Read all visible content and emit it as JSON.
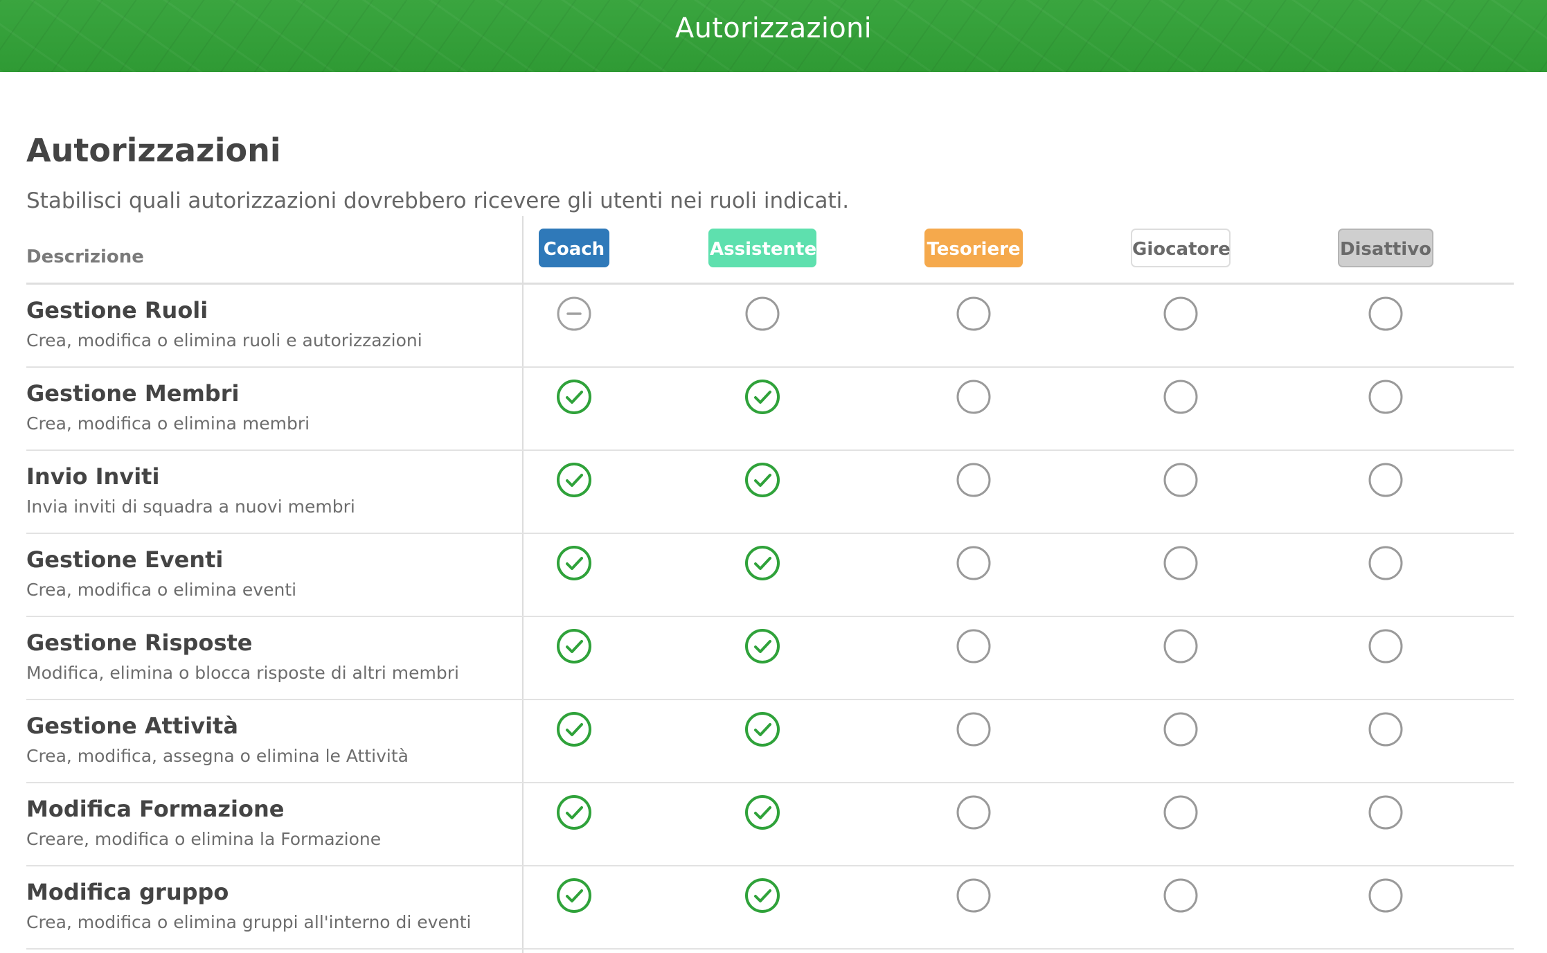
{
  "header": {
    "title": "Autorizzazioni"
  },
  "page": {
    "title": "Autorizzazioni",
    "subtitle": "Stabilisci quali autorizzazioni dovrebbero ricevere gli utenti nei ruoli indicati."
  },
  "table": {
    "description_header": "Descrizione",
    "roles": [
      {
        "label": "Coach",
        "bg": "#2f79b9",
        "fg": "#ffffff",
        "border": "#2f79b9"
      },
      {
        "label": "Assistente",
        "bg": "#5ee0ae",
        "fg": "#ffffff",
        "border": "#5ee0ae"
      },
      {
        "label": "Tesoriere",
        "bg": "#f5a94c",
        "fg": "#ffffff",
        "border": "#f5a94c"
      },
      {
        "label": "Giocatore",
        "bg": "#ffffff",
        "fg": "#6a6a6a",
        "border": "#dddddd"
      },
      {
        "label": "Disattivo",
        "bg": "#cfcfcf",
        "fg": "#6a6a6a",
        "border": "#b5b5b5"
      }
    ],
    "permissions": [
      {
        "title": "Gestione Ruoli",
        "description": "Crea, modifica o elimina ruoli e autorizzazioni",
        "states": [
          "locked",
          "off",
          "off",
          "off",
          "off"
        ]
      },
      {
        "title": "Gestione Membri",
        "description": "Crea, modifica o elimina membri",
        "states": [
          "on",
          "on",
          "off",
          "off",
          "off"
        ]
      },
      {
        "title": "Invio Inviti",
        "description": "Invia inviti di squadra a nuovi membri",
        "states": [
          "on",
          "on",
          "off",
          "off",
          "off"
        ]
      },
      {
        "title": "Gestione Eventi",
        "description": "Crea, modifica o elimina eventi",
        "states": [
          "on",
          "on",
          "off",
          "off",
          "off"
        ]
      },
      {
        "title": "Gestione Risposte",
        "description": "Modifica, elimina o blocca risposte di altri membri",
        "states": [
          "on",
          "on",
          "off",
          "off",
          "off"
        ]
      },
      {
        "title": "Gestione Attività",
        "description": "Crea, modifica, assegna o elimina le Attività",
        "states": [
          "on",
          "on",
          "off",
          "off",
          "off"
        ]
      },
      {
        "title": "Modifica Formazione",
        "description": "Creare, modifica o elimina la Formazione",
        "states": [
          "on",
          "on",
          "off",
          "off",
          "off"
        ]
      },
      {
        "title": "Modifica gruppo",
        "description": "Crea, modifica o elimina gruppi all'interno di eventi",
        "states": [
          "on",
          "on",
          "off",
          "off",
          "off"
        ]
      }
    ]
  },
  "colors": {
    "accent_green": "#2fa23a",
    "off_circle": "#9a9a9a",
    "locked_circle": "#a0a0a0"
  },
  "icons": {
    "on": "check-circle-icon",
    "off": "empty-circle-icon",
    "locked": "minus-circle-icon"
  }
}
